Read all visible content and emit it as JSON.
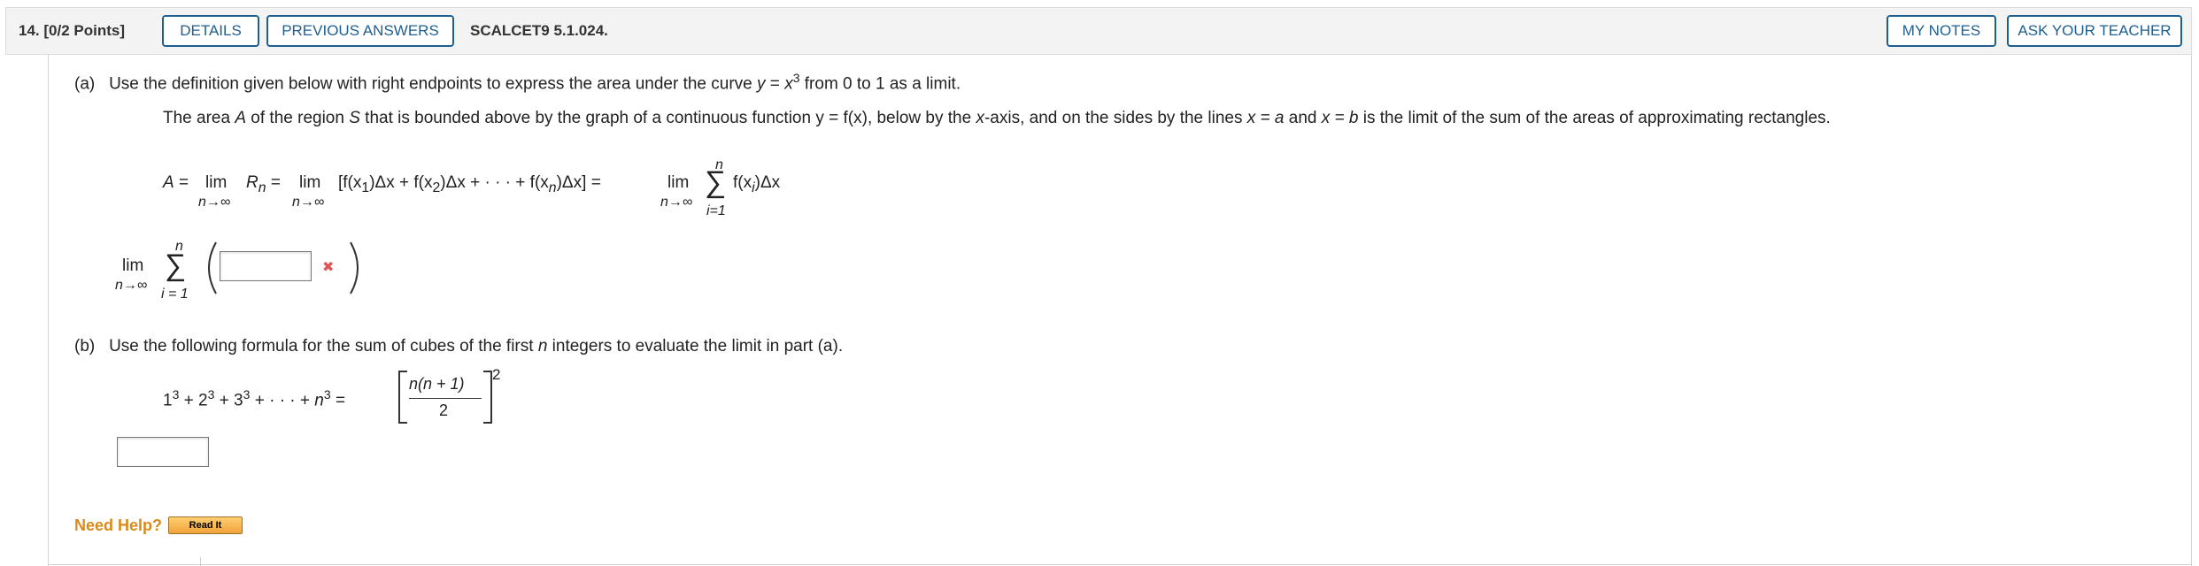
{
  "header": {
    "question_number": "14.",
    "points": "[0/2 Points]",
    "details_label": "DETAILS",
    "previous_answers_label": "PREVIOUS ANSWERS",
    "reference": "SCALCET9 5.1.024.",
    "my_notes_label": "MY NOTES",
    "ask_teacher_label": "ASK YOUR TEACHER"
  },
  "part_a": {
    "label": "(a)",
    "instruction_before": "Use the definition given below with right endpoints to express the area under the curve",
    "curve_var": "y",
    "curve_eq": " = ",
    "curve_expr": "x",
    "curve_exp": "3",
    "instruction_after": "from 0 to 1 as a limit.",
    "definition": {
      "t1": "The area ",
      "A": "A",
      "t2": " of the region ",
      "S": "S",
      "t3": " that is bounded above by the graph of a continuous function ",
      "fn": "y = f(x)",
      "t4": ", below by the ",
      "xaxis": "x",
      "t5": "-axis, and on the sides by the lines ",
      "xa": "x = a",
      "t6": " and ",
      "xb": "x = b",
      "t7": " is the limit of the sum of the areas of approximating rectangles."
    },
    "formula": {
      "A": "A",
      "eq1": "=",
      "lim": "lim",
      "n_to_inf": "n→∞",
      "Rn": "R",
      "Rn_sub": "n",
      "eq2": "=",
      "bracket_sum": "[f(x",
      "sub1": "1",
      "dx1": ")Δx + f(x",
      "sub2": "2",
      "dx2": ")Δx + · · · + f(x",
      "subn": "n",
      "dx3": ")Δx]",
      "eq3": "=",
      "sigma": "∑",
      "sigma_top": "n",
      "sigma_bottom": "i=1",
      "term": "f(x",
      "term_sub": "i",
      "term_end": ")Δx"
    },
    "answer": {
      "lim": "lim",
      "n_to_inf": "n→∞",
      "sigma": "∑",
      "sigma_top": "n",
      "sigma_bottom": "i = 1",
      "input_value": "",
      "status_mark": "✖"
    }
  },
  "part_b": {
    "label": "(b)",
    "instruction_before": "Use the following formula for the sum of cubes of the first",
    "n_var": "n",
    "instruction_after": "integers to evaluate the limit in part (a).",
    "formula": {
      "lhs": "1",
      "lhs_exp": "3",
      "plus2": " + 2",
      "exp2": "3",
      "plus3": " + 3",
      "exp3": "3",
      "dots": " + · · · + ",
      "n": "n",
      "exp_n": "3",
      "eq": " = ",
      "numerator": "n(n + 1)",
      "denominator": "2",
      "outer_exp": "2"
    },
    "input_value": ""
  },
  "help": {
    "need_help_label": "Need Help?",
    "read_it_label": "Read It"
  },
  "colors": {
    "accent_blue": "#1f5f8f",
    "help_orange": "#d98a1a",
    "error_red": "#e05555"
  }
}
